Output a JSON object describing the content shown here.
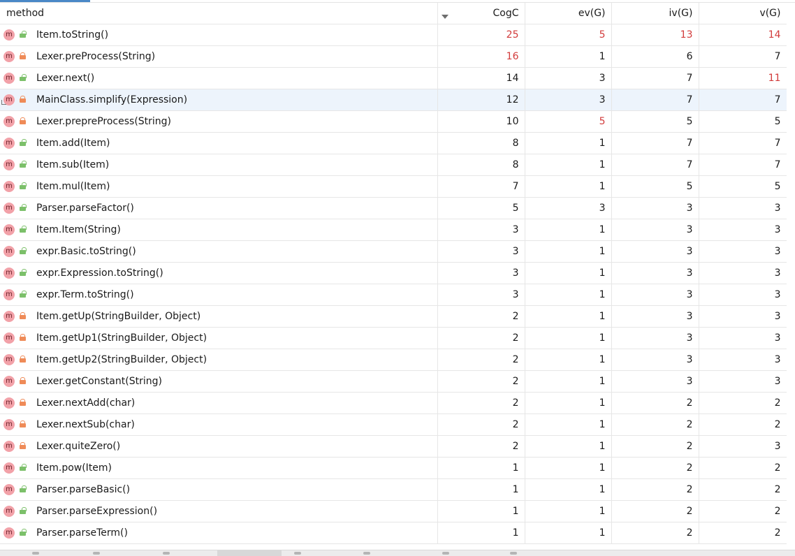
{
  "columns": {
    "method": "method",
    "cogc": "CogC",
    "ev": "ev(G)",
    "iv": "iv(G)",
    "v": "v(G)"
  },
  "rows": [
    {
      "name": "Item.toString()",
      "access": "public",
      "cogc": "25",
      "ev": "5",
      "iv": "13",
      "v": "14",
      "red": [
        "cogc",
        "ev",
        "iv",
        "v"
      ]
    },
    {
      "name": "Lexer.preProcess(String)",
      "access": "private",
      "cogc": "16",
      "ev": "1",
      "iv": "6",
      "v": "7",
      "red": [
        "cogc"
      ]
    },
    {
      "name": "Lexer.next()",
      "access": "public",
      "cogc": "14",
      "ev": "3",
      "iv": "7",
      "v": "11",
      "red": [
        "v"
      ]
    },
    {
      "name": "MainClass.simplify(Expression)",
      "access": "private",
      "cogc": "12",
      "ev": "3",
      "iv": "7",
      "v": "7",
      "red": [],
      "selected": true
    },
    {
      "name": "Lexer.prepreProcess(String)",
      "access": "private",
      "cogc": "10",
      "ev": "5",
      "iv": "5",
      "v": "5",
      "red": [
        "ev"
      ]
    },
    {
      "name": "Item.add(Item)",
      "access": "public",
      "cogc": "8",
      "ev": "1",
      "iv": "7",
      "v": "7",
      "red": []
    },
    {
      "name": "Item.sub(Item)",
      "access": "public",
      "cogc": "8",
      "ev": "1",
      "iv": "7",
      "v": "7",
      "red": []
    },
    {
      "name": "Item.mul(Item)",
      "access": "public",
      "cogc": "7",
      "ev": "1",
      "iv": "5",
      "v": "5",
      "red": []
    },
    {
      "name": "Parser.parseFactor()",
      "access": "public",
      "cogc": "5",
      "ev": "3",
      "iv": "3",
      "v": "3",
      "red": []
    },
    {
      "name": "Item.Item(String)",
      "access": "public",
      "cogc": "3",
      "ev": "1",
      "iv": "3",
      "v": "3",
      "red": []
    },
    {
      "name": "expr.Basic.toString()",
      "access": "public",
      "cogc": "3",
      "ev": "1",
      "iv": "3",
      "v": "3",
      "red": []
    },
    {
      "name": "expr.Expression.toString()",
      "access": "public",
      "cogc": "3",
      "ev": "1",
      "iv": "3",
      "v": "3",
      "red": []
    },
    {
      "name": "expr.Term.toString()",
      "access": "public",
      "cogc": "3",
      "ev": "1",
      "iv": "3",
      "v": "3",
      "red": []
    },
    {
      "name": "Item.getUp(StringBuilder, Object)",
      "access": "private",
      "cogc": "2",
      "ev": "1",
      "iv": "3",
      "v": "3",
      "red": []
    },
    {
      "name": "Item.getUp1(StringBuilder, Object)",
      "access": "private",
      "cogc": "2",
      "ev": "1",
      "iv": "3",
      "v": "3",
      "red": []
    },
    {
      "name": "Item.getUp2(StringBuilder, Object)",
      "access": "private",
      "cogc": "2",
      "ev": "1",
      "iv": "3",
      "v": "3",
      "red": []
    },
    {
      "name": "Lexer.getConstant(String)",
      "access": "private",
      "cogc": "2",
      "ev": "1",
      "iv": "3",
      "v": "3",
      "red": []
    },
    {
      "name": "Lexer.nextAdd(char)",
      "access": "private",
      "cogc": "2",
      "ev": "1",
      "iv": "2",
      "v": "2",
      "red": []
    },
    {
      "name": "Lexer.nextSub(char)",
      "access": "private",
      "cogc": "2",
      "ev": "1",
      "iv": "2",
      "v": "2",
      "red": []
    },
    {
      "name": "Lexer.quiteZero()",
      "access": "private",
      "cogc": "2",
      "ev": "1",
      "iv": "2",
      "v": "3",
      "red": []
    },
    {
      "name": "Item.pow(Item)",
      "access": "public",
      "cogc": "1",
      "ev": "1",
      "iv": "2",
      "v": "2",
      "red": []
    },
    {
      "name": "Parser.parseBasic()",
      "access": "public",
      "cogc": "1",
      "ev": "1",
      "iv": "2",
      "v": "2",
      "red": []
    },
    {
      "name": "Parser.parseExpression()",
      "access": "public",
      "cogc": "1",
      "ev": "1",
      "iv": "2",
      "v": "2",
      "red": []
    },
    {
      "name": "Parser.parseTerm()",
      "access": "public",
      "cogc": "1",
      "ev": "1",
      "iv": "2",
      "v": "2",
      "red": []
    }
  ],
  "icons": {
    "method": "method-m-icon",
    "public": "public-lock-icon",
    "private": "private-lock-icon",
    "sort": "sort-descending-icon"
  },
  "colors": {
    "highlight": "#d23b3b",
    "selection": "#edf4fc",
    "accent": "#4a88c7"
  }
}
